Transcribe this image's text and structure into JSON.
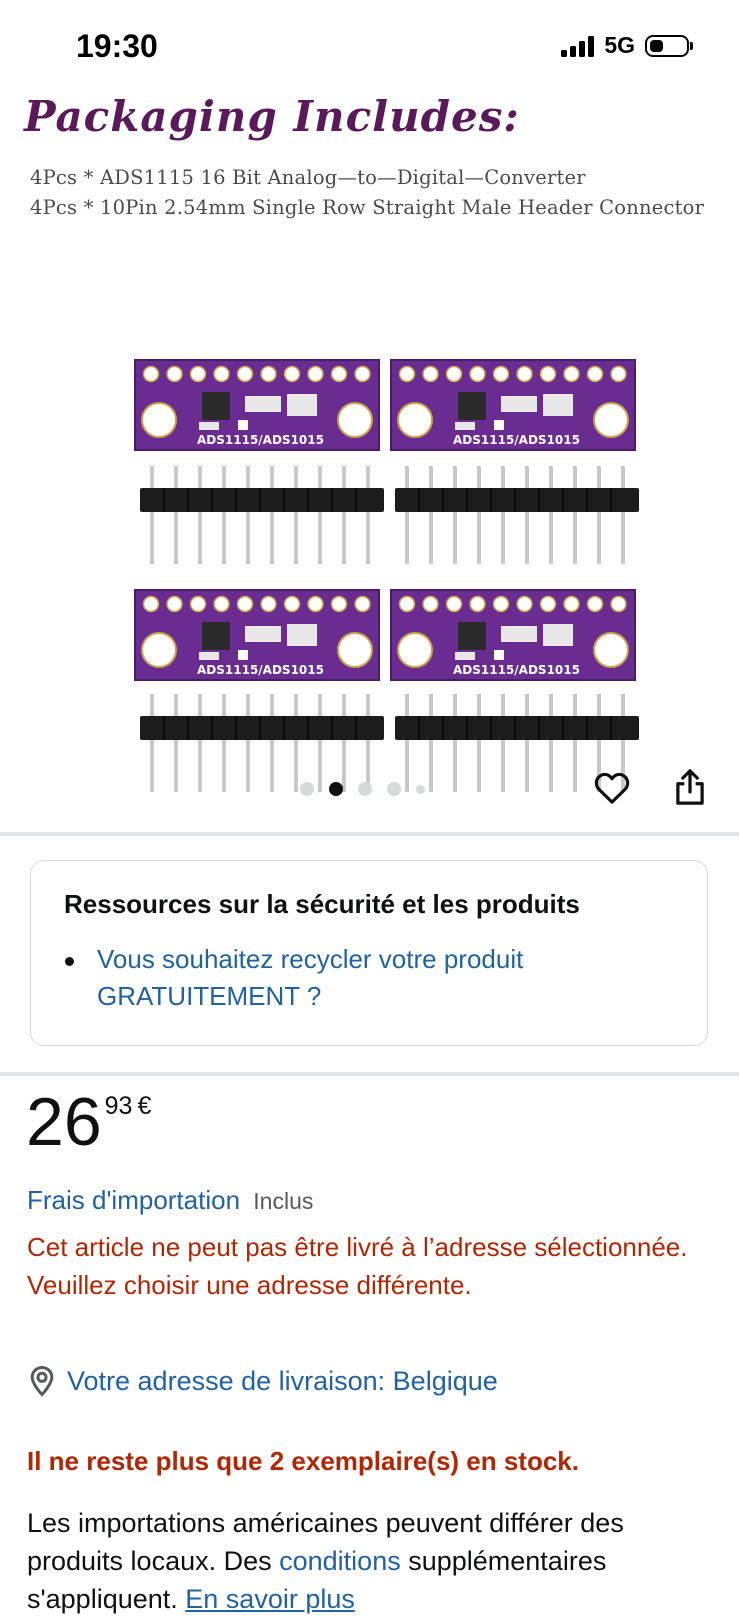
{
  "status_bar": {
    "time": "19:30",
    "network": "5G",
    "icons": [
      "signal-icon",
      "battery-icon"
    ]
  },
  "product_image": {
    "title": "Packaging Includes:",
    "line1": "4Pcs * ADS1115 16 Bit Analog—to—Digital—Converter",
    "line2": "4Pcs * 10Pin 2.54mm Single Row Straight Male Header Connector",
    "board_label": "ADS1115/ADS1015",
    "board_color": "#6a2c91"
  },
  "carousel": {
    "image_count": 5,
    "active_index": 1,
    "icons": [
      "heart-icon",
      "share-icon"
    ]
  },
  "resources": {
    "title": "Ressources sur la sécurité et les produits",
    "item": "Vous souhaitez recycler votre produit GRATUITEMENT ?"
  },
  "price": {
    "whole": "26",
    "fraction": "93",
    "currency": "€"
  },
  "import_fees": {
    "link": "Frais d'importation",
    "status": "Inclus"
  },
  "delivery_warning": "Cet article ne peut pas être livré à l’adresse sélectionnée. Veuillez choisir une adresse différente.",
  "address": {
    "icon": "location-pin-icon",
    "text": "Votre adresse de livraison: Belgique"
  },
  "stock": "Il ne reste plus que 2 exemplaire(s) en stock.",
  "import_note": {
    "text_before": "Les importations américaines peuvent différer des produits locaux. Des ",
    "link1": "conditions",
    "text_middle": " supplémentaires s'appliquent. ",
    "link2": "En savoir plus"
  },
  "colors": {
    "link": "#2162a1",
    "alert": "#b12704",
    "text": "#0f1111"
  }
}
